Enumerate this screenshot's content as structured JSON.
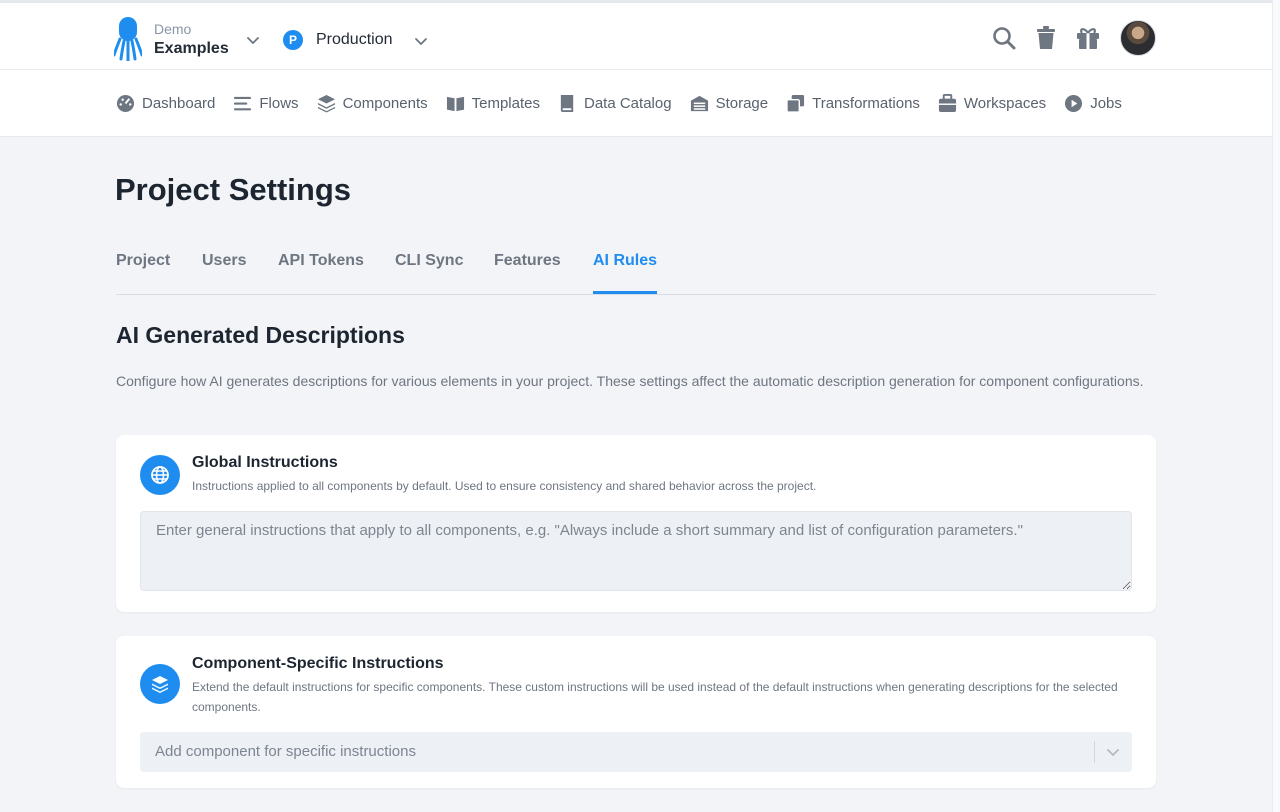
{
  "header": {
    "org_label": "Demo",
    "org_name": "Examples",
    "project_badge": "P",
    "project_name": "Production",
    "accent_color": "#1f8cf0",
    "icons": [
      "search-icon",
      "trash-icon",
      "gift-icon"
    ]
  },
  "nav": {
    "items": [
      {
        "label": "Dashboard",
        "icon": "dashboard-icon"
      },
      {
        "label": "Flows",
        "icon": "flows-icon"
      },
      {
        "label": "Components",
        "icon": "components-icon"
      },
      {
        "label": "Templates",
        "icon": "templates-icon"
      },
      {
        "label": "Data Catalog",
        "icon": "data-catalog-icon"
      },
      {
        "label": "Storage",
        "icon": "storage-icon"
      },
      {
        "label": "Transformations",
        "icon": "transformations-icon"
      },
      {
        "label": "Workspaces",
        "icon": "workspaces-icon"
      },
      {
        "label": "Jobs",
        "icon": "jobs-icon"
      }
    ]
  },
  "page": {
    "title": "Project Settings",
    "tabs": [
      {
        "label": "Project"
      },
      {
        "label": "Users"
      },
      {
        "label": "API Tokens"
      },
      {
        "label": "CLI Sync"
      },
      {
        "label": "Features"
      },
      {
        "label": "AI Rules",
        "active": true
      }
    ]
  },
  "section": {
    "title": "AI Generated Descriptions",
    "description": "Configure how AI generates descriptions for various elements in your project. These settings affect the automatic description generation for component configurations."
  },
  "global_card": {
    "icon": "globe-icon",
    "title": "Global Instructions",
    "subtitle": "Instructions applied to all components by default. Used to ensure consistency and shared behavior across the project.",
    "textarea_value": "",
    "textarea_placeholder": "Enter general instructions that apply to all components, e.g. \"Always include a short summary and list of configuration parameters.\""
  },
  "component_card": {
    "icon": "layers-icon",
    "title": "Component-Specific Instructions",
    "subtitle": "Extend the default instructions for specific components. These custom instructions will be used instead of the default instructions when generating descriptions for the selected components.",
    "select_placeholder": "Add component for specific instructions"
  }
}
